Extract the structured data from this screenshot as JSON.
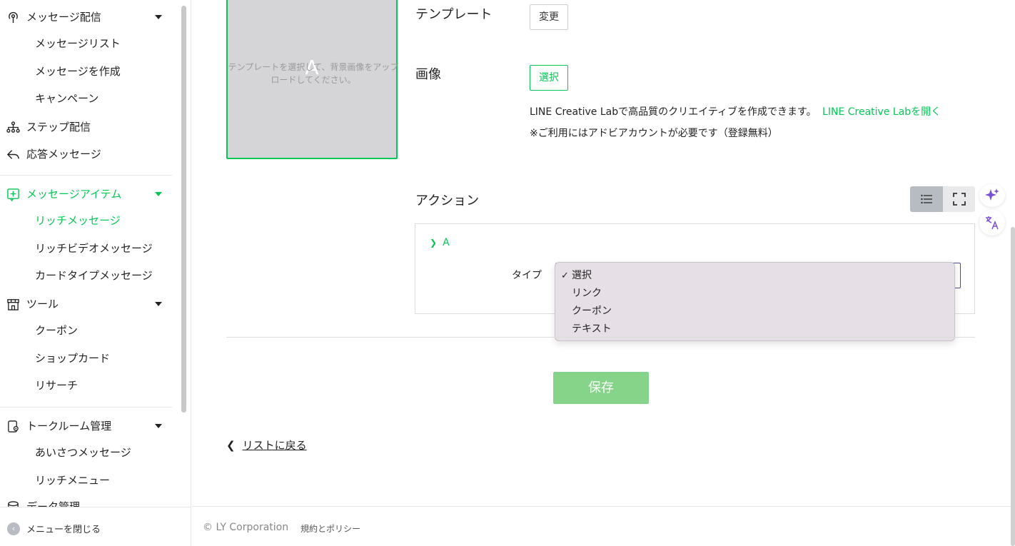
{
  "sidebar": {
    "groups": [
      {
        "label": "メッセージ配信",
        "icon": "broadcast-icon"
      },
      {
        "label": "ステップ配信",
        "icon": "step-tree-icon"
      },
      {
        "label": "応答メッセージ",
        "icon": "reply-arrow-icon"
      },
      {
        "label": "メッセージアイテム",
        "icon": "plus-square-icon"
      },
      {
        "label": "ツール",
        "icon": "shop-icon"
      },
      {
        "label": "トークルーム管理",
        "icon": "chat-settings-icon"
      },
      {
        "label": "データ管理",
        "icon": "database-icon"
      }
    ],
    "items": {
      "message_list": "メッセージリスト",
      "create_message": "メッセージを作成",
      "campaign": "キャンペーン",
      "rich_message": "リッチメッセージ",
      "rich_video": "リッチビデオメッセージ",
      "card_type": "カードタイプメッセージ",
      "coupon": "クーポン",
      "shop_card": "ショップカード",
      "research": "リサーチ",
      "greeting": "あいさつメッセージ",
      "rich_menu": "リッチメニュー"
    },
    "close_menu": "メニューを閉じる"
  },
  "preview": {
    "letter": "A",
    "hint_line1": "テンプレートを選択して、背景画像をアップ",
    "hint_line2": "ロードしてください。"
  },
  "template": {
    "label": "テンプレート",
    "change_button": "変更"
  },
  "image": {
    "label": "画像",
    "select_button": "選択",
    "info_text": "LINE Creative Labで高品質のクリエイティブを作成できます。",
    "info_link": "LINE Creative Labを開く",
    "note": "※ご利用にはアドビアカウントが必要です（登録無料）"
  },
  "action": {
    "label": "アクション",
    "area_label": "A",
    "type_label": "タイプ",
    "options": [
      "選択",
      "リンク",
      "クーポン",
      "テキスト"
    ],
    "selected": "選択"
  },
  "save_button": "保存",
  "back_link": "リストに戻る",
  "footer": {
    "copyright": "© LY Corporation",
    "policy": "規約とポリシー"
  },
  "colors": {
    "brand_green": "#06c755",
    "save_disabled": "#86d38a",
    "ai_purple": "#7b4fd6"
  }
}
